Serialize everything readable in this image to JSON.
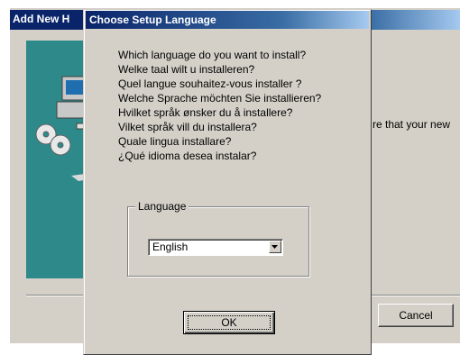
{
  "background_window": {
    "title": "Add New H",
    "body_text": "re that your new",
    "cancel_label": "Cancel"
  },
  "dialog": {
    "title": "Choose Setup Language",
    "questions": [
      "Which language do you want to install?",
      "Welke taal wilt u installeren?",
      "Quel langue souhaitez-vous installer ?",
      "Welche Sprache möchten Sie installieren?",
      "Hvilket språk ønsker du å installere?",
      "Vilket språk vill du installera?",
      "Quale lingua installare?",
      "¿Qué idioma desea instalar?"
    ],
    "language_group_label": "Language",
    "language_selected": "English",
    "ok_label": "OK"
  },
  "colors": {
    "titlebar_active": "#0a246a",
    "face": "#d4d0c8",
    "wizard_art": "#2e8a8a"
  },
  "icons": [
    "computer-illustration-icon",
    "cd-discs-icon",
    "chevron-down-icon"
  ]
}
